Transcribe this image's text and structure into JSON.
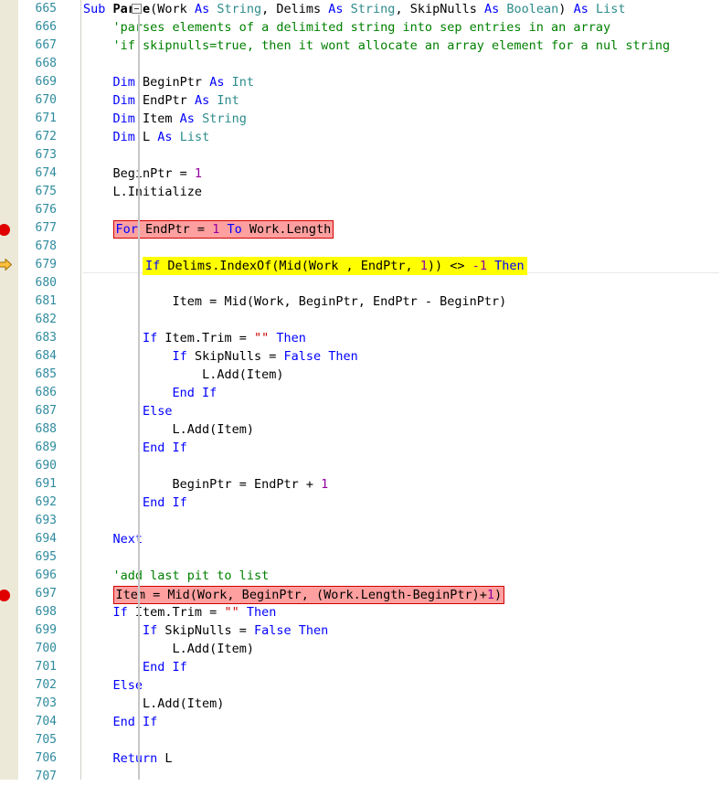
{
  "editor": {
    "language": "Basic4android",
    "colors": {
      "keyword": "#0000ff",
      "type": "#2e8b8b",
      "comment": "#008000",
      "string": "#cc0000",
      "number": "#9400a0",
      "identifier": "#000000",
      "line_number": "#2e8b9e",
      "breakpoint_fill": "#ffa0a0",
      "breakpoint_border": "#d00000",
      "current_line_fill": "#ffff00",
      "breakpoint_marker": "#e00000",
      "execution_arrow": "#ffc040",
      "gutter_background": "#ece9d8"
    },
    "fold_marker": "collapse-minus-box",
    "first_line_number": 665,
    "last_line_number": 707
  },
  "lines": [
    {
      "n": "665",
      "marker": "none",
      "highlight": "none",
      "indent": 0,
      "tokens": [
        {
          "t": "Sub ",
          "c": "kw"
        },
        {
          "t": "Parse",
          "c": "fn"
        },
        {
          "t": "(",
          "c": "op"
        },
        {
          "t": "Work ",
          "c": "idn"
        },
        {
          "t": "As ",
          "c": "kw"
        },
        {
          "t": "String",
          "c": "typ"
        },
        {
          "t": ", ",
          "c": "op"
        },
        {
          "t": "Delims ",
          "c": "idn"
        },
        {
          "t": "As ",
          "c": "kw"
        },
        {
          "t": "String",
          "c": "typ"
        },
        {
          "t": ", ",
          "c": "op"
        },
        {
          "t": "SkipNulls ",
          "c": "idn"
        },
        {
          "t": "As ",
          "c": "kw"
        },
        {
          "t": "Boolean",
          "c": "typ"
        },
        {
          "t": ") ",
          "c": "op"
        },
        {
          "t": "As ",
          "c": "kw"
        },
        {
          "t": "List",
          "c": "typ"
        }
      ]
    },
    {
      "n": "666",
      "marker": "none",
      "highlight": "none",
      "indent": 4,
      "tokens": [
        {
          "t": "'parses elements of a delimited string into sep entries in an array",
          "c": "com"
        }
      ]
    },
    {
      "n": "667",
      "marker": "none",
      "highlight": "none",
      "indent": 4,
      "tokens": [
        {
          "t": "'if skipnulls=true, then it wont allocate an array element for a nul string",
          "c": "com"
        }
      ]
    },
    {
      "n": "668",
      "marker": "none",
      "highlight": "none",
      "indent": 0,
      "tokens": []
    },
    {
      "n": "669",
      "marker": "none",
      "highlight": "none",
      "indent": 4,
      "tokens": [
        {
          "t": "Dim ",
          "c": "kw"
        },
        {
          "t": "BeginPtr ",
          "c": "idn"
        },
        {
          "t": "As ",
          "c": "kw"
        },
        {
          "t": "Int",
          "c": "typ"
        }
      ]
    },
    {
      "n": "670",
      "marker": "none",
      "highlight": "none",
      "indent": 4,
      "tokens": [
        {
          "t": "Dim ",
          "c": "kw"
        },
        {
          "t": "EndPtr ",
          "c": "idn"
        },
        {
          "t": "As ",
          "c": "kw"
        },
        {
          "t": "Int",
          "c": "typ"
        }
      ]
    },
    {
      "n": "671",
      "marker": "none",
      "highlight": "none",
      "indent": 4,
      "tokens": [
        {
          "t": "Dim ",
          "c": "kw"
        },
        {
          "t": "Item ",
          "c": "idn"
        },
        {
          "t": "As ",
          "c": "kw"
        },
        {
          "t": "String",
          "c": "typ"
        }
      ]
    },
    {
      "n": "672",
      "marker": "none",
      "highlight": "none",
      "indent": 4,
      "tokens": [
        {
          "t": "Dim ",
          "c": "kw"
        },
        {
          "t": "L ",
          "c": "idn"
        },
        {
          "t": "As ",
          "c": "kw"
        },
        {
          "t": "List",
          "c": "typ"
        }
      ]
    },
    {
      "n": "673",
      "marker": "none",
      "highlight": "none",
      "indent": 0,
      "tokens": []
    },
    {
      "n": "674",
      "marker": "none",
      "highlight": "none",
      "indent": 4,
      "tokens": [
        {
          "t": "BeginPtr = ",
          "c": "idn"
        },
        {
          "t": "1",
          "c": "num"
        }
      ]
    },
    {
      "n": "675",
      "marker": "none",
      "highlight": "none",
      "indent": 4,
      "tokens": [
        {
          "t": "L.Initialize",
          "c": "idn"
        }
      ]
    },
    {
      "n": "676",
      "marker": "none",
      "highlight": "none",
      "indent": 0,
      "tokens": []
    },
    {
      "n": "677",
      "marker": "breakpoint",
      "highlight": "breakpoint",
      "indent": 4,
      "tokens": [
        {
          "t": "For ",
          "c": "kw"
        },
        {
          "t": "EndPtr = ",
          "c": "idn"
        },
        {
          "t": "1",
          "c": "num"
        },
        {
          "t": " To ",
          "c": "kw"
        },
        {
          "t": "Work.Length",
          "c": "idn"
        }
      ]
    },
    {
      "n": "678",
      "marker": "none",
      "highlight": "none",
      "indent": 0,
      "tokens": []
    },
    {
      "n": "679",
      "marker": "execution-arrow",
      "highlight": "current",
      "indent": 8,
      "tokens": [
        {
          "t": "If ",
          "c": "kw"
        },
        {
          "t": "Delims.IndexOf(Mid(Work , EndPtr, ",
          "c": "idn"
        },
        {
          "t": "1",
          "c": "num"
        },
        {
          "t": ")) <> ",
          "c": "idn"
        },
        {
          "t": "-1",
          "c": "num"
        },
        {
          "t": " Then",
          "c": "kw"
        }
      ]
    },
    {
      "n": "680",
      "marker": "none",
      "highlight": "none",
      "indent": 0,
      "tokens": []
    },
    {
      "n": "681",
      "marker": "none",
      "highlight": "none",
      "indent": 12,
      "tokens": [
        {
          "t": "Item = Mid(Work, BeginPtr, EndPtr - BeginPtr)",
          "c": "idn"
        }
      ]
    },
    {
      "n": "682",
      "marker": "none",
      "highlight": "none",
      "indent": 0,
      "tokens": []
    },
    {
      "n": "683",
      "marker": "none",
      "highlight": "none",
      "indent": 8,
      "tokens": [
        {
          "t": "If ",
          "c": "kw"
        },
        {
          "t": "Item.Trim = ",
          "c": "idn"
        },
        {
          "t": "\"\"",
          "c": "str"
        },
        {
          "t": " Then",
          "c": "kw"
        }
      ]
    },
    {
      "n": "684",
      "marker": "none",
      "highlight": "none",
      "indent": 12,
      "tokens": [
        {
          "t": "If ",
          "c": "kw"
        },
        {
          "t": "SkipNulls = ",
          "c": "idn"
        },
        {
          "t": "False Then",
          "c": "kw"
        }
      ]
    },
    {
      "n": "685",
      "marker": "none",
      "highlight": "none",
      "indent": 16,
      "tokens": [
        {
          "t": "L.Add(Item)",
          "c": "idn"
        }
      ]
    },
    {
      "n": "686",
      "marker": "none",
      "highlight": "none",
      "indent": 12,
      "tokens": [
        {
          "t": "End If",
          "c": "kw"
        }
      ]
    },
    {
      "n": "687",
      "marker": "none",
      "highlight": "none",
      "indent": 8,
      "tokens": [
        {
          "t": "Else",
          "c": "kw"
        }
      ]
    },
    {
      "n": "688",
      "marker": "none",
      "highlight": "none",
      "indent": 12,
      "tokens": [
        {
          "t": "L.Add(Item)",
          "c": "idn"
        }
      ]
    },
    {
      "n": "689",
      "marker": "none",
      "highlight": "none",
      "indent": 8,
      "tokens": [
        {
          "t": "End If",
          "c": "kw"
        }
      ]
    },
    {
      "n": "690",
      "marker": "none",
      "highlight": "none",
      "indent": 0,
      "tokens": []
    },
    {
      "n": "691",
      "marker": "none",
      "highlight": "none",
      "indent": 12,
      "tokens": [
        {
          "t": "BeginPtr = EndPtr + ",
          "c": "idn"
        },
        {
          "t": "1",
          "c": "num"
        }
      ]
    },
    {
      "n": "692",
      "marker": "none",
      "highlight": "none",
      "indent": 8,
      "tokens": [
        {
          "t": "End If",
          "c": "kw"
        }
      ]
    },
    {
      "n": "693",
      "marker": "none",
      "highlight": "none",
      "indent": 0,
      "tokens": []
    },
    {
      "n": "694",
      "marker": "none",
      "highlight": "none",
      "indent": 4,
      "tokens": [
        {
          "t": "Next",
          "c": "kw"
        }
      ]
    },
    {
      "n": "695",
      "marker": "none",
      "highlight": "none",
      "indent": 0,
      "tokens": []
    },
    {
      "n": "696",
      "marker": "none",
      "highlight": "none",
      "indent": 4,
      "tokens": [
        {
          "t": "'add last pit to list",
          "c": "com"
        }
      ]
    },
    {
      "n": "697",
      "marker": "breakpoint",
      "highlight": "breakpoint",
      "indent": 4,
      "tokens": [
        {
          "t": "Item = Mid(Work, BeginPtr, (Work.Length-BeginPtr)+",
          "c": "idn"
        },
        {
          "t": "1",
          "c": "num"
        },
        {
          "t": ")",
          "c": "idn"
        }
      ]
    },
    {
      "n": "698",
      "marker": "none",
      "highlight": "none",
      "indent": 4,
      "tokens": [
        {
          "t": "If ",
          "c": "kw"
        },
        {
          "t": "Item.Trim = ",
          "c": "idn"
        },
        {
          "t": "\"\"",
          "c": "str"
        },
        {
          "t": " Then",
          "c": "kw"
        }
      ]
    },
    {
      "n": "699",
      "marker": "none",
      "highlight": "none",
      "indent": 8,
      "tokens": [
        {
          "t": "If ",
          "c": "kw"
        },
        {
          "t": "SkipNulls = ",
          "c": "idn"
        },
        {
          "t": "False Then",
          "c": "kw"
        }
      ]
    },
    {
      "n": "700",
      "marker": "none",
      "highlight": "none",
      "indent": 12,
      "tokens": [
        {
          "t": "L.Add(Item)",
          "c": "idn"
        }
      ]
    },
    {
      "n": "701",
      "marker": "none",
      "highlight": "none",
      "indent": 8,
      "tokens": [
        {
          "t": "End If",
          "c": "kw"
        }
      ]
    },
    {
      "n": "702",
      "marker": "none",
      "highlight": "none",
      "indent": 4,
      "tokens": [
        {
          "t": "Else",
          "c": "kw"
        }
      ]
    },
    {
      "n": "703",
      "marker": "none",
      "highlight": "none",
      "indent": 8,
      "tokens": [
        {
          "t": "L.Add(Item)",
          "c": "idn"
        }
      ]
    },
    {
      "n": "704",
      "marker": "none",
      "highlight": "none",
      "indent": 4,
      "tokens": [
        {
          "t": "End If",
          "c": "kw"
        }
      ]
    },
    {
      "n": "705",
      "marker": "none",
      "highlight": "none",
      "indent": 0,
      "tokens": []
    },
    {
      "n": "706",
      "marker": "none",
      "highlight": "none",
      "indent": 4,
      "tokens": [
        {
          "t": "Return ",
          "c": "kw"
        },
        {
          "t": "L",
          "c": "idn"
        }
      ]
    },
    {
      "n": "707",
      "marker": "none",
      "highlight": "none",
      "indent": 0,
      "tokens": []
    }
  ]
}
